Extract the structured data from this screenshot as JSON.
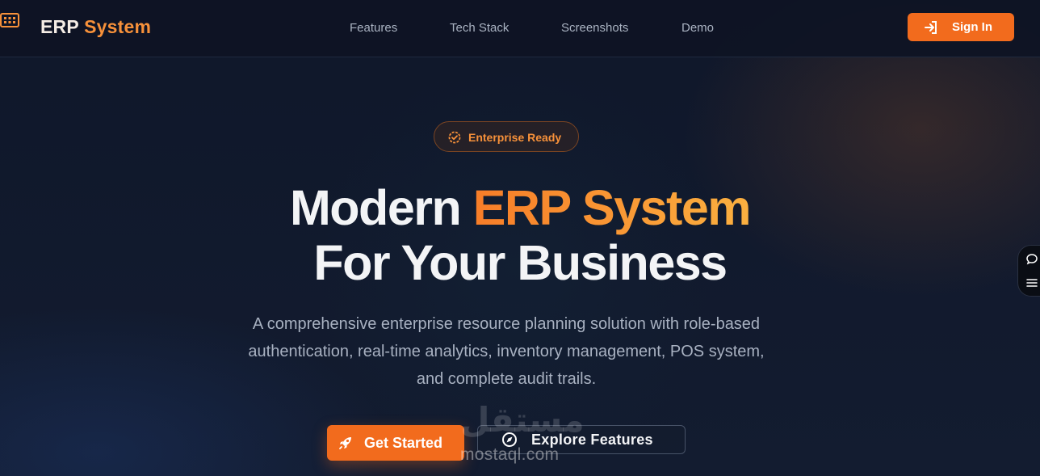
{
  "header": {
    "brand_part1": "ERP",
    "brand_part2": "System",
    "logo_icon": "building-grid-icon",
    "nav": [
      "Features",
      "Tech Stack",
      "Screenshots",
      "Demo"
    ],
    "sign_in_label": "Sign In",
    "sign_in_icon": "login-arrow-icon"
  },
  "hero": {
    "badge_label": "Enterprise Ready",
    "badge_icon": "verified-badge-icon",
    "title_line1_plain": "Modern ",
    "title_line1_accent": "ERP System",
    "title_line2": "For Your Business",
    "description_lines": [
      "A comprehensive enterprise resource planning solution with role-based",
      "authentication, real-time analytics, inventory management, POS system,",
      "and complete audit trails."
    ],
    "cta_primary": "Get Started",
    "cta_primary_icon": "rocket-icon",
    "cta_secondary": "Explore Features",
    "cta_secondary_icon": "compass-icon"
  },
  "side_widget": {
    "icons": [
      "chat-bubble-icon",
      "menu-lines-icon"
    ]
  },
  "watermark": {
    "arabic": "مستقل",
    "latin": "mostaql.com"
  },
  "colors": {
    "accent": "#f26b1d",
    "accent_light": "#fbb040",
    "background": "#111a2e"
  }
}
